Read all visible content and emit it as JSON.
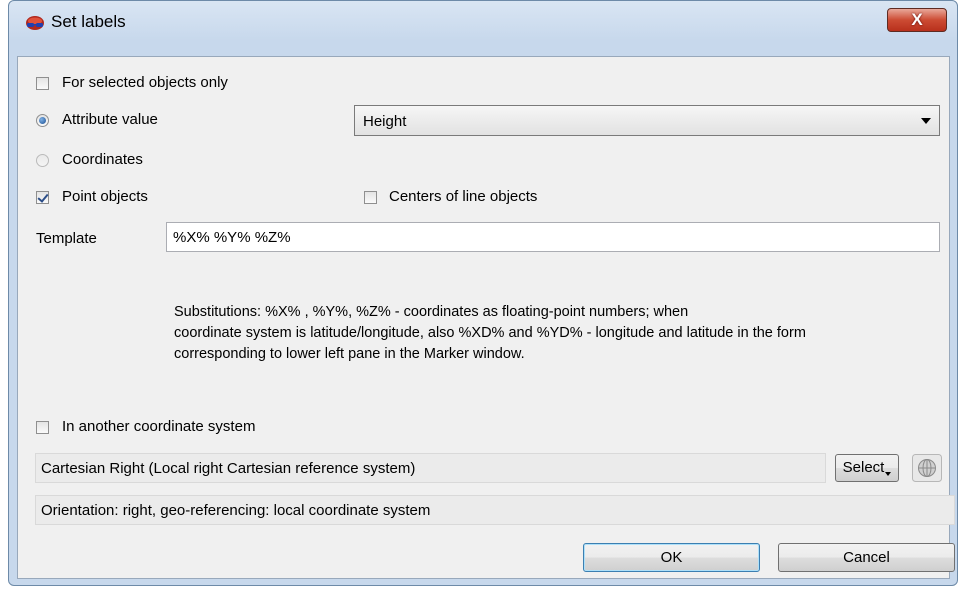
{
  "window": {
    "title": "Set labels",
    "close_label": "X"
  },
  "form": {
    "selected_only": {
      "label": "For selected objects only",
      "checked": false
    },
    "attribute_value": {
      "label": "Attribute value",
      "selected": true
    },
    "attribute_combo": {
      "value": "Height"
    },
    "coordinates": {
      "label": "Coordinates",
      "selected": false
    },
    "point_objects": {
      "label": "Point objects",
      "checked": true
    },
    "centers_line": {
      "label": "Centers of line objects",
      "checked": false
    },
    "template": {
      "label": "Template",
      "value": "%X% %Y% %Z%"
    },
    "substitutions": [
      "Substitutions: %X% , %Y%, %Z% - coordinates as floating-point numbers; when",
      " coordinate system is latitude/longitude, also %XD% and %YD% - longitude and latitude in the form",
      " corresponding to lower left pane in the Marker window."
    ],
    "other_cs": {
      "label": "In another coordinate system",
      "checked": false
    },
    "cs_name": "Cartesian Right (Local right Cartesian reference system)",
    "select_button": "Select",
    "orientation": "Orientation: right, geo-referencing: local coordinate system"
  },
  "buttons": {
    "ok": "OK",
    "cancel": "Cancel"
  },
  "icons": [
    "app-icon",
    "close-icon",
    "chevron-down-icon",
    "globe-icon",
    "dropdown-arrow-icon"
  ]
}
